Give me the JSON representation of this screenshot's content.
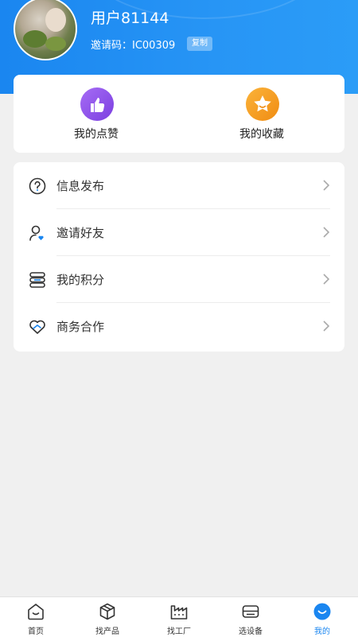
{
  "profile": {
    "username": "用户81144",
    "invite_code": "邀请码：IC00309",
    "copy_label": "复制"
  },
  "quick": [
    {
      "label": "我的点赞",
      "icon": "thumbs-up-icon",
      "color": "#8a54e8"
    },
    {
      "label": "我的收藏",
      "icon": "star-icon",
      "color": "#f59f1b"
    }
  ],
  "menu": [
    {
      "label": "信息发布",
      "icon": "question-circle-icon"
    },
    {
      "label": "邀请好友",
      "icon": "user-heart-icon"
    },
    {
      "label": "我的积分",
      "icon": "coin-stack-icon"
    },
    {
      "label": "商务合作",
      "icon": "handshake-heart-icon"
    }
  ],
  "tabs": [
    {
      "label": "首页",
      "icon": "home-icon",
      "active": false
    },
    {
      "label": "找产品",
      "icon": "box-icon",
      "active": false
    },
    {
      "label": "找工厂",
      "icon": "factory-icon",
      "active": false
    },
    {
      "label": "选设备",
      "icon": "device-icon",
      "active": false
    },
    {
      "label": "我的",
      "icon": "profile-icon",
      "active": true
    }
  ],
  "colors": {
    "primary": "#1a86f0",
    "background": "#f0f0f0"
  }
}
